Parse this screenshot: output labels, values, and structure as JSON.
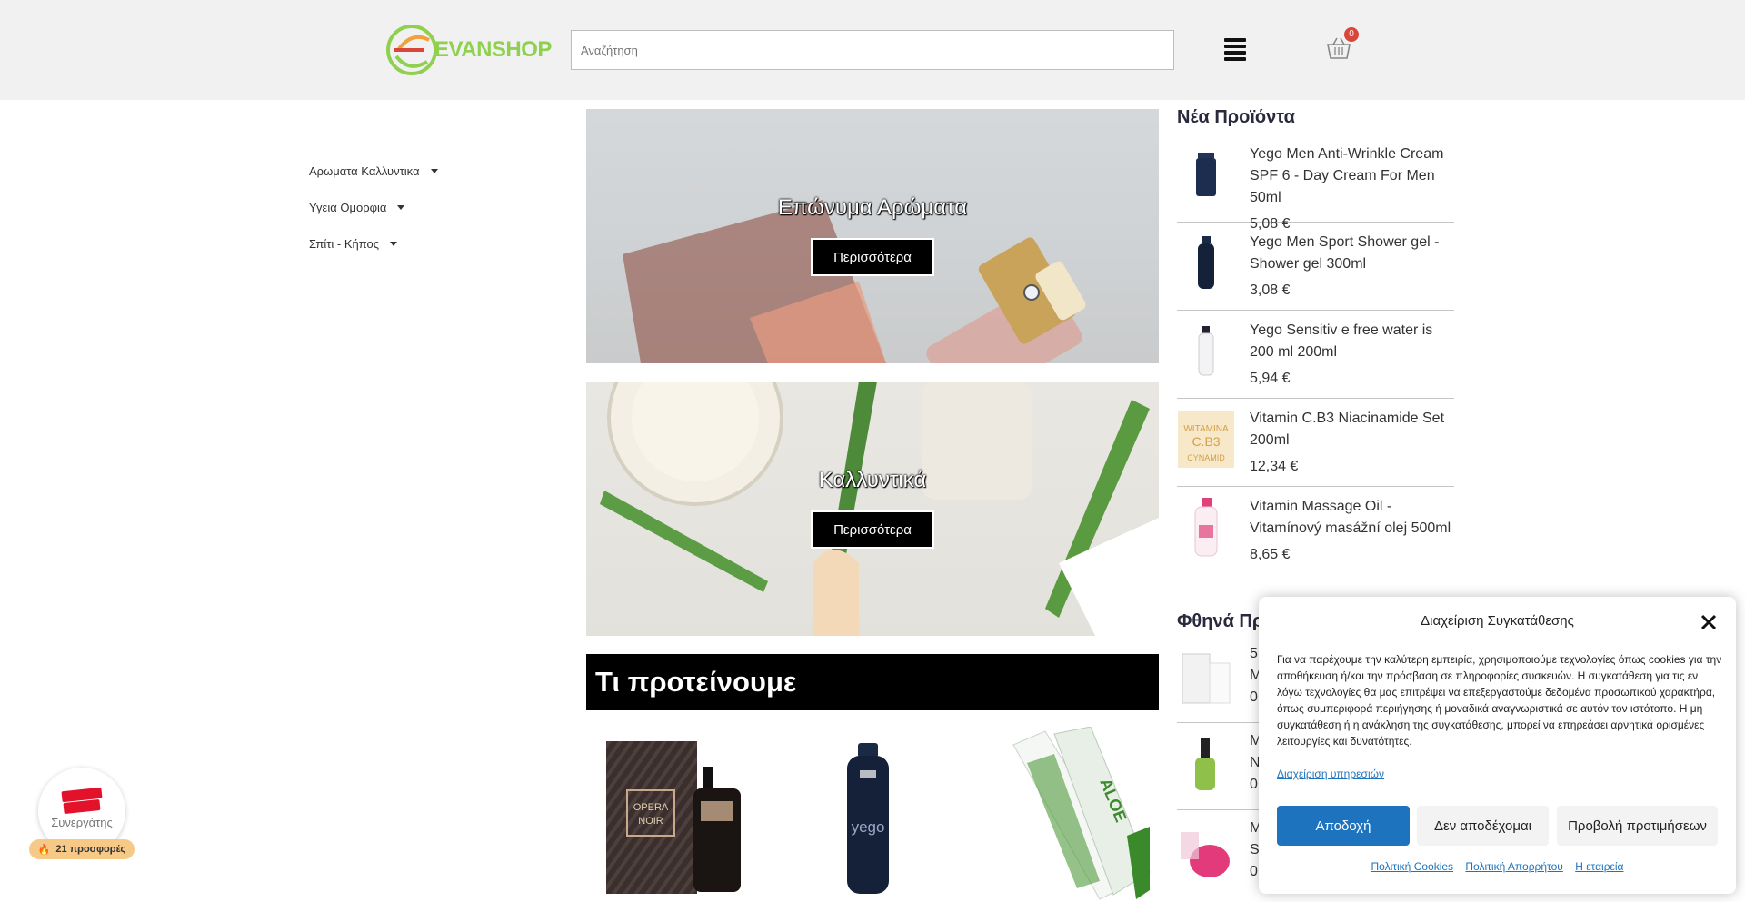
{
  "header": {
    "logo_text": "EVANSHOP",
    "search_placeholder": "Αναζήτηση",
    "cart_count": "0"
  },
  "sidebar": {
    "items": [
      {
        "label": "Αρωματα Καλλυντικα"
      },
      {
        "label": "Υγεια Ομορφια"
      },
      {
        "label": "Σπίτι - Κήπος"
      }
    ]
  },
  "banners": [
    {
      "title": "Επώνυμα Αρώματα",
      "button": "Περισσότερα"
    },
    {
      "title": "Καλλυντικά",
      "button": "Περισσότερα"
    }
  ],
  "recommend": {
    "title": "Τι προτείνουμε"
  },
  "new_products": {
    "title": "Νέα Προϊόντα",
    "items": [
      {
        "name": "Yego Men Anti-Wrinkle Cream SPF 6 - Day Cream For Men 50ml",
        "price": "5,08 €"
      },
      {
        "name": "Yego Men Sport Shower gel - Shower gel 300ml",
        "price": "3,08 €"
      },
      {
        "name": "Yego Sensitiv e free water is 200 ml 200ml",
        "price": "5,94 €"
      },
      {
        "name": "Vitamin C.B3 Niacinamide Set 200ml",
        "price": "12,34 €"
      },
      {
        "name": "Vitamin Massage Oil - Vitamínový masážní olej 500ml",
        "price": "8,65 €"
      }
    ]
  },
  "cheap_products": {
    "title": "Φθηνά Πρ",
    "items": [
      {
        "line1": "5",
        "line2": "M",
        "line3": "0"
      },
      {
        "line1": "M",
        "line2": "N",
        "line3": "0"
      },
      {
        "line1": "M",
        "line2": "S",
        "line3": "0"
      }
    ]
  },
  "cookie": {
    "title": "Διαχείριση Συγκατάθεσης",
    "body": "Για να παρέχουμε την καλύτερη εμπειρία, χρησιμοποιούμε τεχνολογίες όπως cookies για την αποθήκευση ή/και την πρόσβαση σε πληροφορίες συσκευών. Η συγκατάθεση για τις εν λόγω τεχνολογίες θα μας επιτρέψει να επεξεργαστούμε δεδομένα προσωπικού χαρακτήρα, όπως συμπεριφορά περιήγησης ή μοναδικά αναγνωριστικά σε αυτόν τον ιστότοπο. Η μη συγκατάθεση ή η ανάκληση της συγκατάθεσης, μπορεί να επηρεάσει αρνητικά ορισμένες λειτουργίες και δυνατότητες.",
    "manage_link": "Διαχείριση υπηρεσιών",
    "accept": "Αποδοχή",
    "deny": "Δεν αποδέχομαι",
    "preferences": "Προβολή προτιμήσεων",
    "footer_links": [
      "Πολιτική Cookies",
      "Πολιτική Απορρήτου",
      "Η εταιρεία"
    ]
  },
  "bestprice": {
    "label": "Συνεργάτης",
    "offers": "21 προσφορές"
  },
  "colors": {
    "header_bg": "#f1f1f1",
    "accept_blue": "#1e73be",
    "badge_red": "#d9473b",
    "logo_green": "#8fd14f"
  }
}
